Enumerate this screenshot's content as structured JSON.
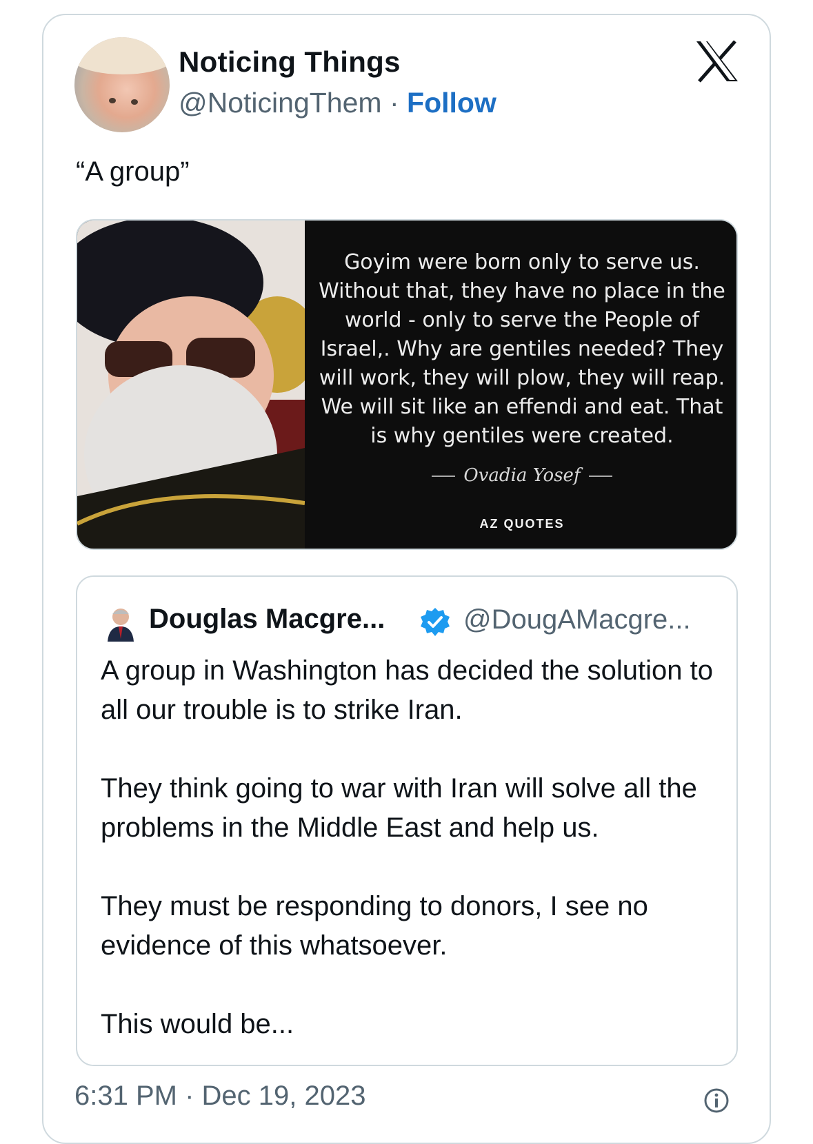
{
  "author": {
    "name": "Noticing Things",
    "handle": "@NoticingThem",
    "separator": "·",
    "follow_label": "Follow"
  },
  "brand_icon": "x-logo-icon",
  "tweet": {
    "text": "“A group”"
  },
  "media": {
    "quote": "Goyim were born only to serve us. Without that, they have no place in the world - only to serve the People of Israel,. Why are gentiles needed? They will work, they will plow, they will reap. We will sit like an effendi and eat. That is why gentiles were created.",
    "attribution": "Ovadia Yosef",
    "brand": "AZ QUOTES"
  },
  "quoted_tweet": {
    "name": "Douglas Macgre...",
    "handle": "@DougAMacgre...",
    "verified_icon": "verified-badge-icon",
    "paragraphs": [
      "A group in Washington has decided the solution to all our trouble is to strike Iran.",
      "They think going to war with Iran will solve all the problems in the Middle East and help us.",
      "They must be responding to donors, I see no evidence of this whatsoever.",
      "This would be..."
    ]
  },
  "footer": {
    "timestamp": "6:31 PM · Dec 19, 2023",
    "info_icon": "info-icon"
  },
  "colors": {
    "follow": "#1d6fc4",
    "verified": "#1d9bf0",
    "secondary_text": "#536471",
    "border": "#cfd9de"
  }
}
